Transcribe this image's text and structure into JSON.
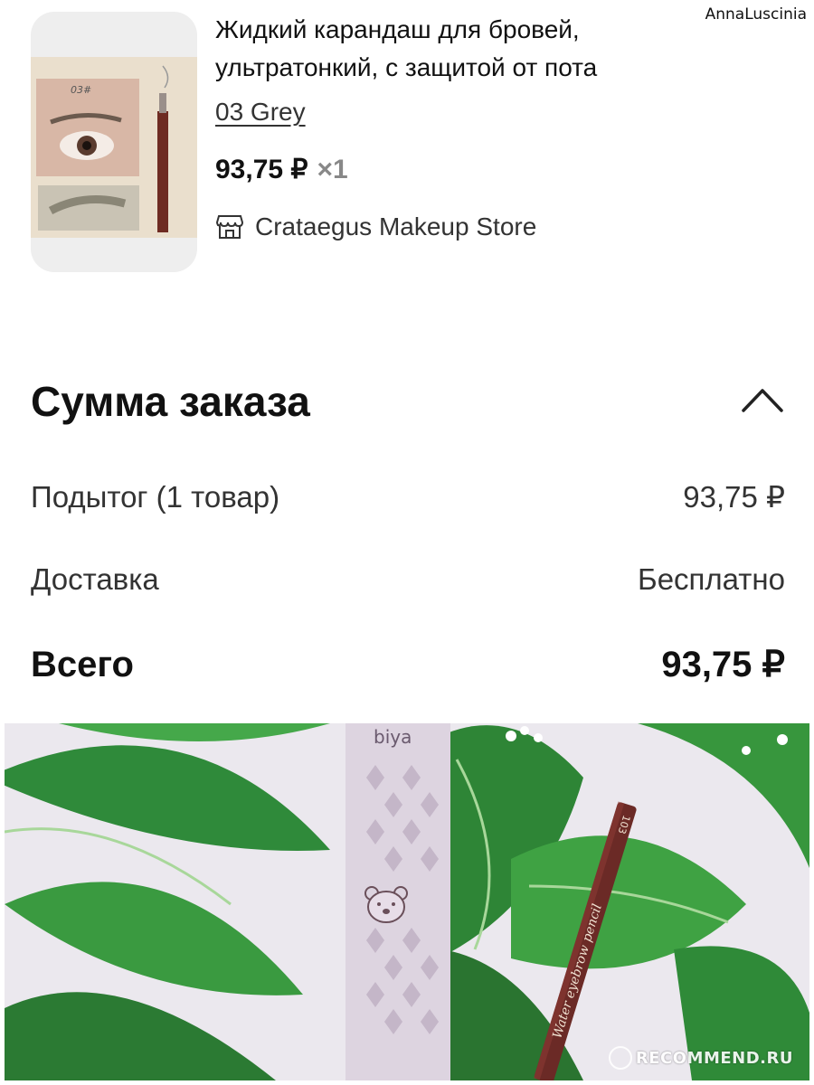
{
  "watermark_top": "AnnaLuscinia",
  "product": {
    "title": "Жидкий карандаш для бровей, ультратонкий, с защитой от пота",
    "variant": "03 Grey",
    "price": "93,75 ₽",
    "quantity": "×1",
    "store": "Crataegus Makeup Store",
    "store_icon": "store-icon",
    "thumbnail_label": "03#"
  },
  "summary": {
    "title": "Сумма заказа",
    "collapse_icon": "chevron-up-icon",
    "rows": [
      {
        "label": "Подытог (1 товар)",
        "value": "93,75 ₽"
      },
      {
        "label": "Доставка",
        "value": "Бесплатно"
      },
      {
        "label": "Всего",
        "value": "93,75 ₽"
      }
    ]
  },
  "photo": {
    "box_brand": "biya",
    "pencil_text": "Water eyebrow pencil",
    "pencil_number": "103"
  },
  "watermark_bottom": "RECOMMEND.RU"
}
